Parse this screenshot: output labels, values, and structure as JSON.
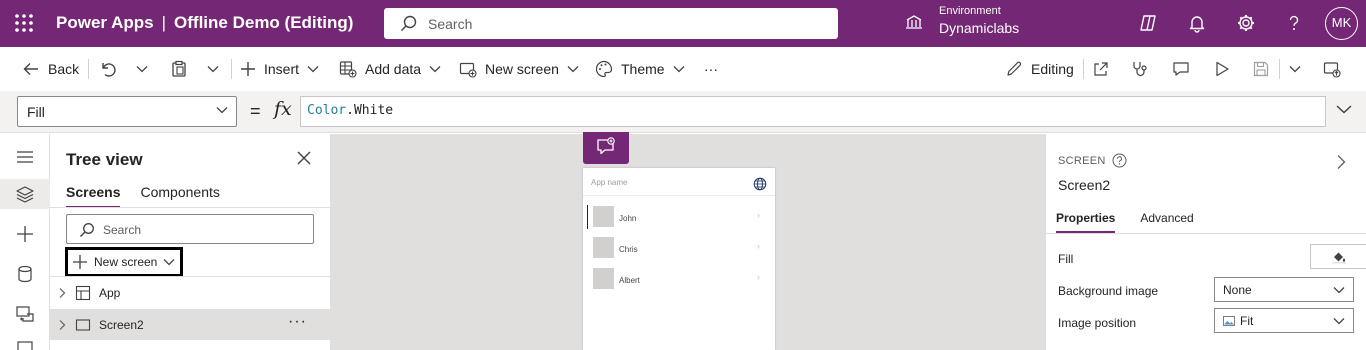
{
  "header": {
    "product": "Power Apps",
    "separator": "|",
    "app_title": "Offline Demo (Editing)",
    "search_placeholder": "Search",
    "environment_label": "Environment",
    "environment_value": "Dynamiclabs",
    "avatar_initials": "MK",
    "icons": [
      "waffle-icon",
      "search-icon",
      "environment-icon",
      "copilot-icon",
      "bell-icon",
      "gear-icon",
      "help-icon"
    ]
  },
  "toolbar": {
    "back": "Back",
    "insert": "Insert",
    "add_data": "Add data",
    "new_screen": "New screen",
    "theme": "Theme",
    "more": "···",
    "editing": "Editing"
  },
  "formula_bar": {
    "property": "Fill",
    "equals": "=",
    "fx": "fx",
    "formula_object": "Color",
    "formula_member": ".White"
  },
  "tree_view": {
    "title": "Tree view",
    "tabs": [
      "Screens",
      "Components"
    ],
    "selected_tab": "Screens",
    "search_placeholder": "Search",
    "new_screen": "New screen",
    "items": [
      {
        "label": "App",
        "selected": false
      },
      {
        "label": "Screen2",
        "selected": true
      }
    ],
    "more": "···"
  },
  "canvas": {
    "app_name_placeholder": "App name",
    "list_items": [
      "John",
      "Chris",
      "Albert"
    ]
  },
  "properties_pane": {
    "kind": "SCREEN",
    "name": "Screen2",
    "tabs": [
      "Properties",
      "Advanced"
    ],
    "selected_tab": "Properties",
    "fill_label": "Fill",
    "fill_color": "#FFFFFF",
    "background_image_label": "Background image",
    "background_image_value": "None",
    "image_position_label": "Image position",
    "image_position_value": "Fit"
  },
  "colors": {
    "brand": "#742774",
    "canvas": "#E1DFDD"
  }
}
